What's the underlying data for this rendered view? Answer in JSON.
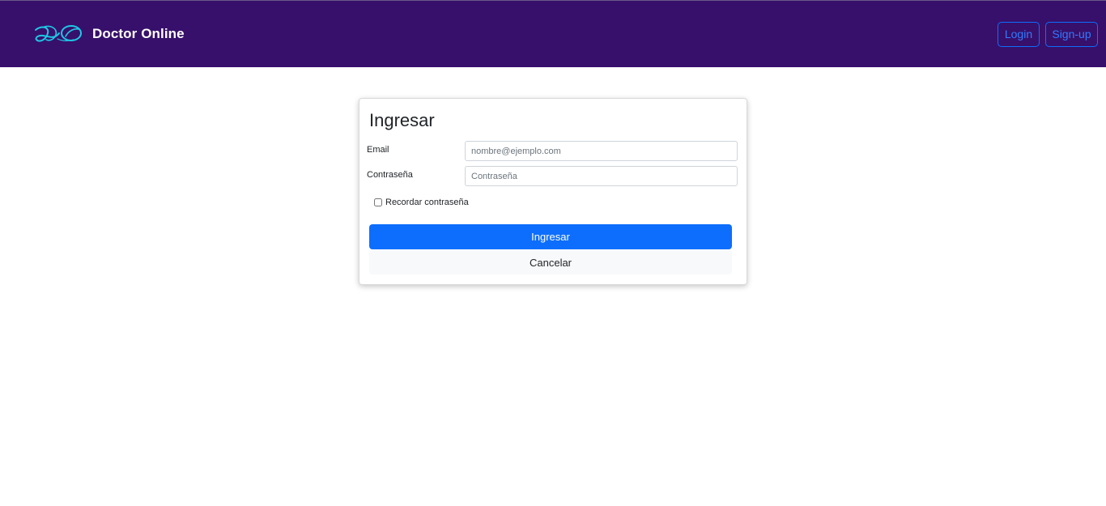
{
  "navbar": {
    "brand_name": "Doctor Online",
    "logo_icon": "do-monogram-icon",
    "login_label": "Login",
    "signup_label": "Sign-up"
  },
  "login_form": {
    "title": "Ingresar",
    "email_label": "Email",
    "email_placeholder": "nombre@ejemplo.com",
    "email_value": "",
    "password_label": "Contraseña",
    "password_placeholder": "Contraseña",
    "password_value": "",
    "remember_label": "Recordar contraseña",
    "remember_checked": false,
    "submit_label": "Ingresar",
    "cancel_label": "Cancelar"
  },
  "colors": {
    "navbar_bg": "#37106b",
    "logo_cyan": "#1ec8e6",
    "primary": "#0d6efd",
    "light": "#f8f9fa"
  }
}
